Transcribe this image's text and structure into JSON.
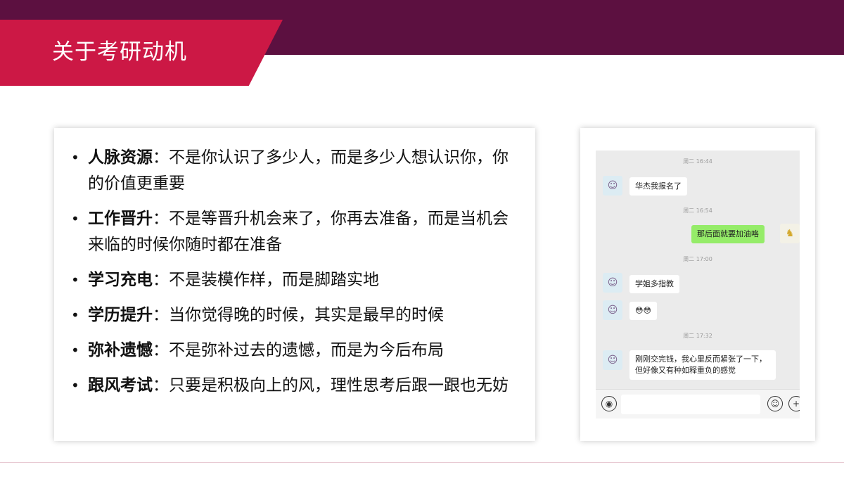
{
  "slide": {
    "title": "关于考研动机"
  },
  "motivations": [
    {
      "term": "人脉资源",
      "text": "：不是你认识了多少人，而是多少人想认识你，你的价值更重要"
    },
    {
      "term": "工作晋升",
      "text": "：不是等晋升机会来了，你再去准备，而是当机会来临的时候你随时都在准备"
    },
    {
      "term": "学习充电",
      "text": "：不是装模作样，而是脚踏实地"
    },
    {
      "term": "学历提升",
      "text": "：当你觉得晚的时候，其实是最早的时候"
    },
    {
      "term": "弥补遗憾",
      "text": "：不是弥补过去的遗憾，而是为今后布局"
    },
    {
      "term": "跟风考试",
      "text": "：只要是积极向上的风，理性思考后跟一跟也无妨"
    }
  ],
  "chat": {
    "timestamps": [
      "周二 16:44",
      "周二 16:54",
      "周二 17:00",
      "周二 17:32"
    ],
    "messages": [
      {
        "from": "other",
        "text": "华杰我报名了"
      },
      {
        "from": "self",
        "text": "那后面就要加油咯"
      },
      {
        "from": "other",
        "text": "学姐多指教"
      },
      {
        "from": "other",
        "text": "😳😳"
      },
      {
        "from": "other",
        "text": "刚刚交完钱，我心里反而紧张了一下，但好像又有种如释重负的感觉"
      }
    ],
    "icons": {
      "voice": "voice-icon",
      "emoji": "emoji-icon",
      "plus": "plus-icon"
    }
  },
  "colors": {
    "header_band": "#5c1040",
    "title_tab": "#cc1845",
    "self_bubble": "#95ec69"
  }
}
